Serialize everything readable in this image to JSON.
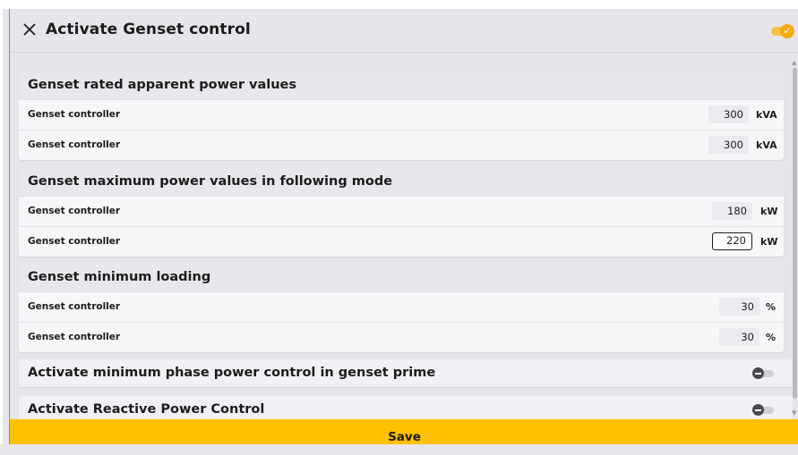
{
  "dialog": {
    "title": "Activate Genset control",
    "close_icon": "close-icon",
    "header_toggle": {
      "state": "on",
      "color": "#f4ab13",
      "icon": "check-icon"
    }
  },
  "sections": [
    {
      "title": "Genset rated apparent power values",
      "rows": [
        {
          "label": "Genset controller",
          "value": "300",
          "unit": "kVA"
        },
        {
          "label": "Genset controller",
          "value": "300",
          "unit": "kVA"
        }
      ]
    },
    {
      "title": "Genset maximum power values in following mode",
      "rows": [
        {
          "label": "Genset controller",
          "value": "180",
          "unit": "kW"
        },
        {
          "label": "Genset controller",
          "value": "220",
          "unit": "kW",
          "focused": true
        }
      ]
    },
    {
      "title": "Genset minimum loading",
      "rows": [
        {
          "label": "Genset controller",
          "value": "30",
          "unit": "%"
        },
        {
          "label": "Genset controller",
          "value": "30",
          "unit": "%"
        }
      ]
    }
  ],
  "toggles": [
    {
      "label": "Activate minimum phase power control in genset prime",
      "state": "off"
    },
    {
      "label": "Activate Reactive Power Control",
      "state": "off"
    }
  ],
  "save_label": "Save",
  "accent_color": "#ffc000"
}
